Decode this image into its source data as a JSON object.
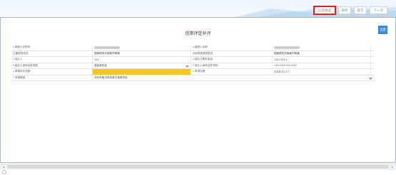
{
  "toolbar": {
    "buttons": [
      {
        "label": "信息预览"
      },
      {
        "label": "保存"
      },
      {
        "label": "提交"
      },
      {
        "label": "下一步"
      }
    ]
  },
  "side_button": {
    "label": "设置"
  },
  "form": {
    "title": "信用评定补评",
    "rows": [
      {
        "left_label": "纳税人识别号",
        "left_value": "",
        "right_label": "纳税人名称",
        "right_value": ""
      },
      {
        "left_label": "主管税务机关",
        "left_value": "国家税务总局某市税局",
        "right_label": "评价机构税务机关",
        "right_value": "国家税务总局某市税局"
      },
      {
        "left_label": "经办人",
        "left_value": "111",
        "right_label": "经办人联系电话",
        "right_value": "11111111"
      },
      {
        "left_label": "经办人身份证件类型",
        "left_value": "居民身份证",
        "right_label": "经办人身份证件号码",
        "right_value": "11111111111111"
      },
      {
        "left_label": "申请评价年度",
        "left_value": "",
        "right_label": "申请日期",
        "right_value": "2018-11-17"
      },
      {
        "left_label": "申请原因",
        "left_value": "评价年度当年未参与信用评定"
      }
    ]
  }
}
